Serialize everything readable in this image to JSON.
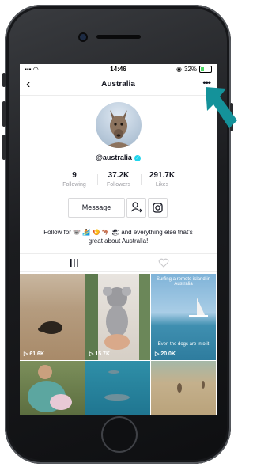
{
  "status_bar": {
    "time": "14:46",
    "battery": "32%"
  },
  "header": {
    "title": "Australia",
    "back_icon": "chevron-left-icon",
    "more_icon": "more-horizontal-icon"
  },
  "profile": {
    "username": "@australia"
  },
  "stats": [
    {
      "value": "9",
      "label": "Following"
    },
    {
      "value": "37.2K",
      "label": "Followers"
    },
    {
      "value": "291.7K",
      "label": "Likes"
    }
  ],
  "actions": {
    "message_label": "Message"
  },
  "bio": {
    "line1": "Follow for 🐨 🏄 🍤 🦘 🏖 and everything else that's",
    "line2": "great about Australia!"
  },
  "videos": [
    {
      "views": "61.6K",
      "caption": ""
    },
    {
      "views": "15.7K",
      "caption": ""
    },
    {
      "views": "20.0K",
      "caption_top": "Surfing a remote island in Australia",
      "caption": "Even the dogs are into it"
    },
    {
      "views": "",
      "caption": ""
    },
    {
      "views": "",
      "caption": ""
    },
    {
      "views": "",
      "caption": ""
    }
  ],
  "colors": {
    "accent_arrow": "#14929a",
    "verified": "#20d5ec",
    "text": "#161823"
  }
}
